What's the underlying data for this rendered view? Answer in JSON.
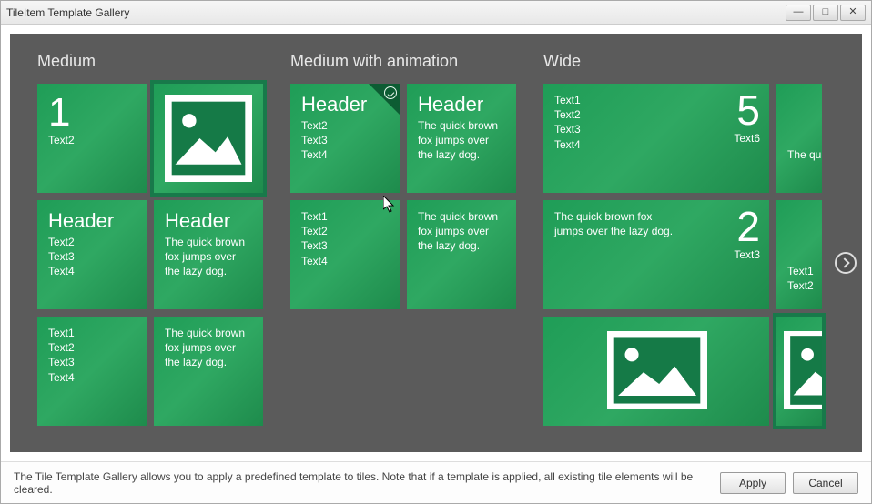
{
  "window": {
    "title": "TileItem Template Gallery"
  },
  "sections": {
    "medium": {
      "title": "Medium",
      "t0_big": "1",
      "t0_sub": "Text2",
      "t2_hdr": "Header",
      "t2_l1": "Text2",
      "t2_l2": "Text3",
      "t2_l3": "Text4",
      "t3_hdr": "Header",
      "t3_body": "The quick brown fox jumps over the lazy dog.",
      "t4_l1": "Text1",
      "t4_l2": "Text2",
      "t4_l3": "Text3",
      "t4_l4": "Text4",
      "t5_body": "The quick brown fox jumps over the lazy dog."
    },
    "anim": {
      "title": "Medium with animation",
      "t0_hdr": "Header",
      "t0_l1": "Text2",
      "t0_l2": "Text3",
      "t0_l3": "Text4",
      "t1_hdr": "Header",
      "t1_body": "The quick brown fox jumps over the lazy dog.",
      "t2_l1": "Text1",
      "t2_l2": "Text2",
      "t2_l3": "Text3",
      "t2_l4": "Text4",
      "t3_body": "The quick brown fox jumps over the lazy dog."
    },
    "wide": {
      "title": "Wide",
      "t0_l1": "Text1",
      "t0_l2": "Text2",
      "t0_l3": "Text3",
      "t0_l4": "Text4",
      "t0_big": "5",
      "t0_rs": "Text6",
      "t0b_body": "The quick brown fox jumps over the lazy dog.",
      "t1_body": "The quick brown fox jumps over the lazy dog.",
      "t1_big": "2",
      "t1_rs": "Text3",
      "t1b_l1": "Text1",
      "t1b_l2": "Text2"
    }
  },
  "footer": {
    "msg": "The Tile Template Gallery allows you to apply a predefined template to tiles. Note that if a template is applied, all existing tile elements will be cleared.",
    "apply": "Apply",
    "cancel": "Cancel"
  }
}
